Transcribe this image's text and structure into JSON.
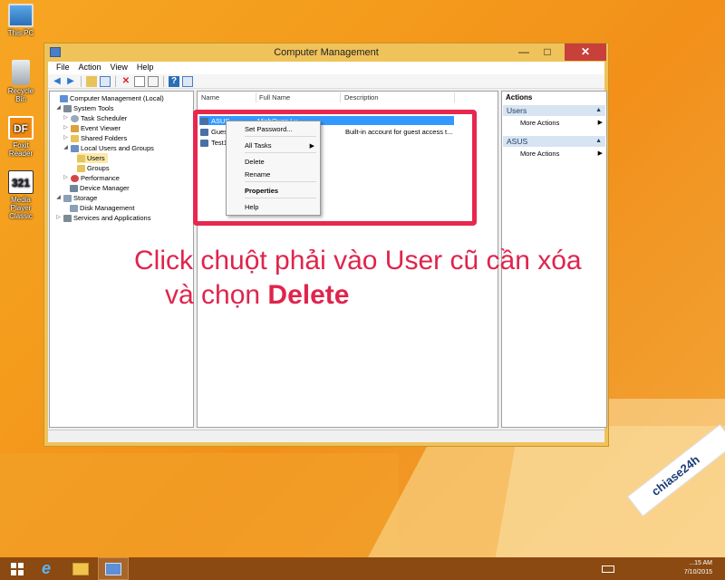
{
  "desktop": {
    "icons": [
      {
        "label": "This PC"
      },
      {
        "label": "Recycle Bin"
      },
      {
        "label": "Foxit Reader"
      },
      {
        "label": "Media Player Classic"
      }
    ]
  },
  "window": {
    "title": "Computer Management",
    "controls": {
      "minimize": "—",
      "maximize": "□",
      "close": "✕"
    },
    "menu": [
      "File",
      "Action",
      "View",
      "Help"
    ]
  },
  "tree": [
    {
      "label": "Computer Management (Local)",
      "icon": "computer-icon"
    },
    {
      "label": "System Tools",
      "icon": "tools-icon"
    },
    {
      "label": "Task Scheduler",
      "icon": "clock-icon"
    },
    {
      "label": "Event Viewer",
      "icon": "event-viewer-icon"
    },
    {
      "label": "Shared Folders",
      "icon": "shared-folder-icon"
    },
    {
      "label": "Local Users and Groups",
      "icon": "users-icon"
    },
    {
      "label": "Users",
      "icon": "folder-icon"
    },
    {
      "label": "Groups",
      "icon": "folder-icon"
    },
    {
      "label": "Performance",
      "icon": "performance-icon"
    },
    {
      "label": "Device Manager",
      "icon": "device-manager-icon"
    },
    {
      "label": "Storage",
      "icon": "storage-icon"
    },
    {
      "label": "Disk Management",
      "icon": "disk-icon"
    },
    {
      "label": "Services and Applications",
      "icon": "services-icon"
    }
  ],
  "list": {
    "columns": [
      "Name",
      "Full Name",
      "Description"
    ],
    "rows": [
      {
        "name": "ASUS",
        "full_name": "MichQuan Lu...",
        "description": ""
      },
      {
        "name": "Guest",
        "full_name": "",
        "description": "Built-in account for guest access t..."
      },
      {
        "name": "Test1",
        "full_name": "",
        "description": ""
      }
    ]
  },
  "context_menu": {
    "items": [
      "Set Password...",
      "All Tasks",
      "Delete",
      "Rename",
      "Properties",
      "Help"
    ]
  },
  "actions": {
    "header": "Actions",
    "sections": [
      {
        "title": "Users",
        "item": "More Actions"
      },
      {
        "title": "ASUS",
        "item": "More Actions"
      }
    ]
  },
  "annotation": {
    "line1": "Click chuột phải vào User cũ cần xóa",
    "line2_prefix": "và chọn ",
    "line2_bold": "Delete"
  },
  "taskbar": {
    "clock_time": "...15 AM",
    "clock_date": "7/10/2015"
  },
  "watermark": "chiase24h"
}
